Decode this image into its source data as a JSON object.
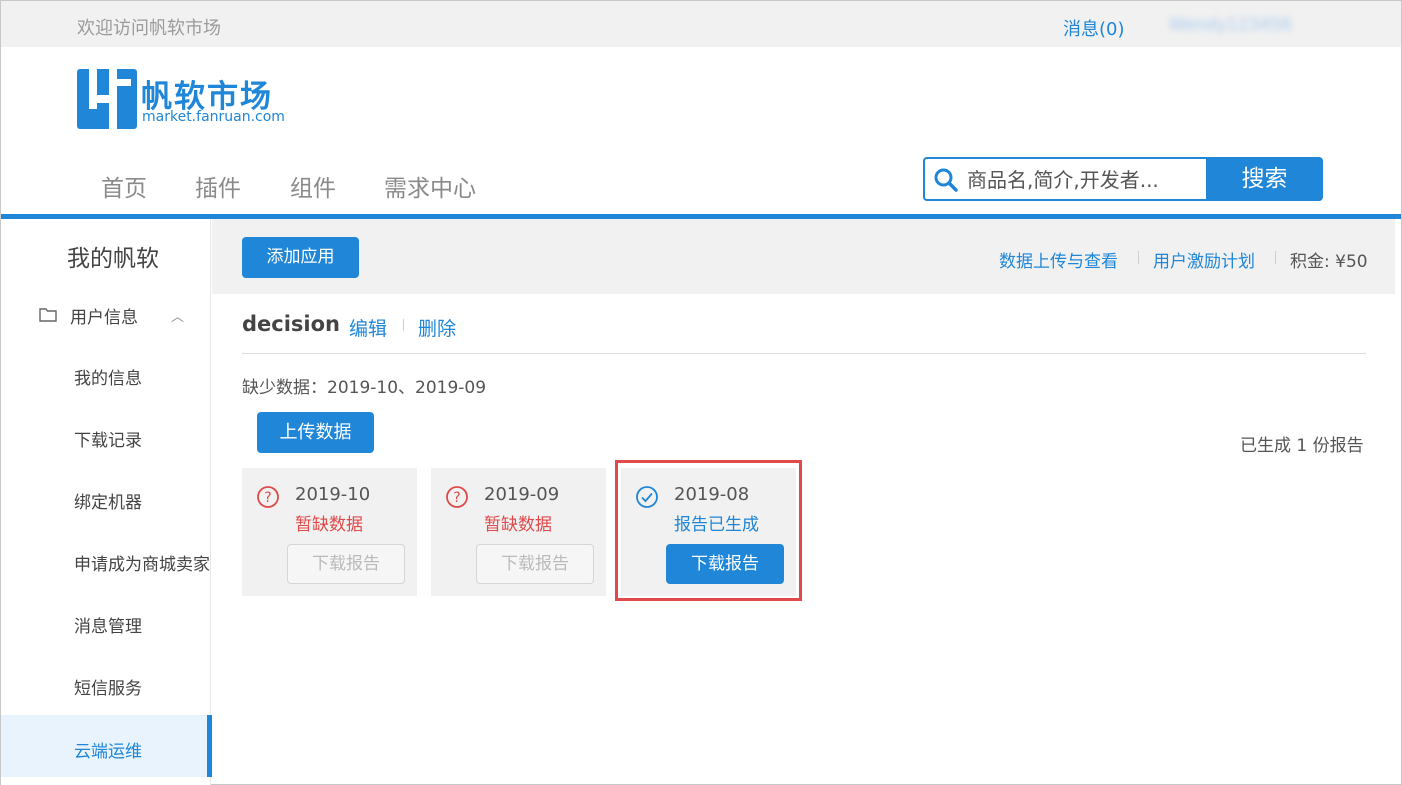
{
  "topbar": {
    "welcome": "欢迎访问帆软市场",
    "messages": "消息(0)",
    "username": "Wendy123456"
  },
  "logo": {
    "title": "帆软市场",
    "subtitle": "market.fanruan.com"
  },
  "nav": {
    "items": [
      "首页",
      "插件",
      "组件",
      "需求中心"
    ]
  },
  "search": {
    "placeholder": "商品名,简介,开发者...",
    "button": "搜索"
  },
  "sidebar": {
    "title": "我的帆软",
    "group_label": "用户信息",
    "items": [
      "我的信息",
      "下载记录",
      "绑定机器",
      "申请成为商城卖家",
      "消息管理",
      "短信服务",
      "云端运维"
    ],
    "active_item": "云端运维"
  },
  "toolbar": {
    "add_app": "添加应用",
    "upload_view": "数据上传与查看",
    "incentive": "用户激励计划",
    "points": "积金: ¥50"
  },
  "app": {
    "name": "decision",
    "edit": "编辑",
    "delete": "删除",
    "missing_data": "缺少数据：2019-10、2019-09",
    "upload_button": "上传数据",
    "generated_count": "已生成 1 份报告"
  },
  "cards": [
    {
      "date": "2019-10",
      "status": "暂缺数据",
      "button": "下载报告",
      "state": "missing"
    },
    {
      "date": "2019-09",
      "status": "暂缺数据",
      "button": "下载报告",
      "state": "missing"
    },
    {
      "date": "2019-08",
      "status": "报告已生成",
      "button": "下载报告",
      "state": "ready"
    }
  ],
  "colors": {
    "accent": "#1f86d8",
    "warning": "#e04a4a",
    "highlight_border": "#e04a4a"
  }
}
